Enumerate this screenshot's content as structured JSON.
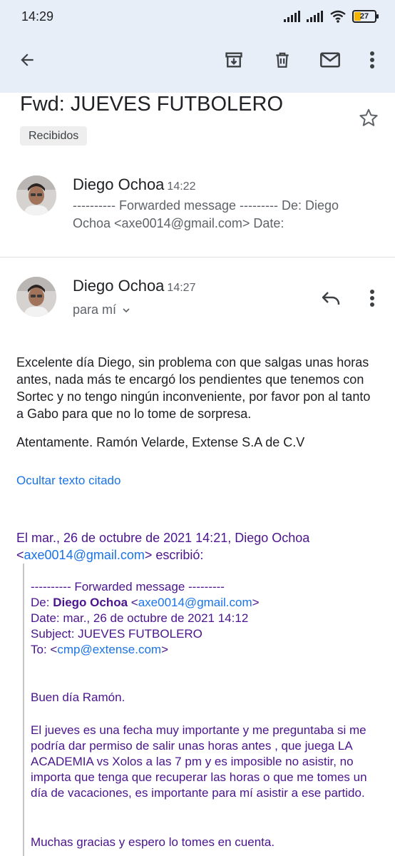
{
  "status_bar": {
    "time": "14:29",
    "battery": "27"
  },
  "toolbar": {
    "back_icon": "arrow-left-icon",
    "archive_icon": "archive-icon",
    "delete_icon": "trash-icon",
    "mark_unread_icon": "mail-icon",
    "more_icon": "more-vert-icon"
  },
  "email": {
    "subject": "Fwd: JUEVES FUTBOLERO",
    "label": "Recibidos"
  },
  "messages": [
    {
      "sender": "Diego Ochoa",
      "time": "14:22",
      "snippet": "---------- Forwarded message --------- De: Diego Ochoa <axe0014@gmail.com> Date:"
    },
    {
      "sender": "Diego Ochoa",
      "time": "14:27",
      "recipient": "para mí",
      "body_1": "Excelente día Diego, sin problema con que salgas unas horas antes, nada más te encargó los pendientes que tenemos con Sortec y no tengo ningún inconveniente, por favor pon al tanto a Gabo para que no lo tome de sorpresa.",
      "body_2": "Atentamente. Ramón Velarde, Extense S.A de C.V",
      "hide_quoted": "Ocultar texto citado"
    }
  ],
  "quote": {
    "header_line1": "El mar., 26 de octubre de 2021 14:21, Diego Ochoa",
    "header_lt": "<",
    "header_email": "axe0014@gmail.com",
    "header_rest": "> escribió:",
    "forwarded_title": "---------- Forwarded message ---------",
    "from_label": "De: ",
    "from_name": "Diego Ochoa",
    "from_lt": " <",
    "from_email": "axe0014@gmail.com",
    "from_gt": ">",
    "date_line": "Date: mar., 26 de octubre de 2021 14:12",
    "subject_line": "Subject: JUEVES FUTBOLERO",
    "to_label": "To: <",
    "to_email": "cmp@extense.com",
    "to_gt": ">",
    "greeting": "Buen día Ramón.",
    "paragraph": "El jueves es una fecha muy importante y me preguntaba si me podría dar permiso de salir unas horas antes , que juega LA ACADEMIA vs Xolos a las 7 pm y es imposible no asistir, no importa que tenga que recuperar las horas o que me tomes un día de vacaciones, es importante para mí asistir a ese partido.",
    "closing": "Muchas gracias y espero lo tomes en cuenta."
  }
}
